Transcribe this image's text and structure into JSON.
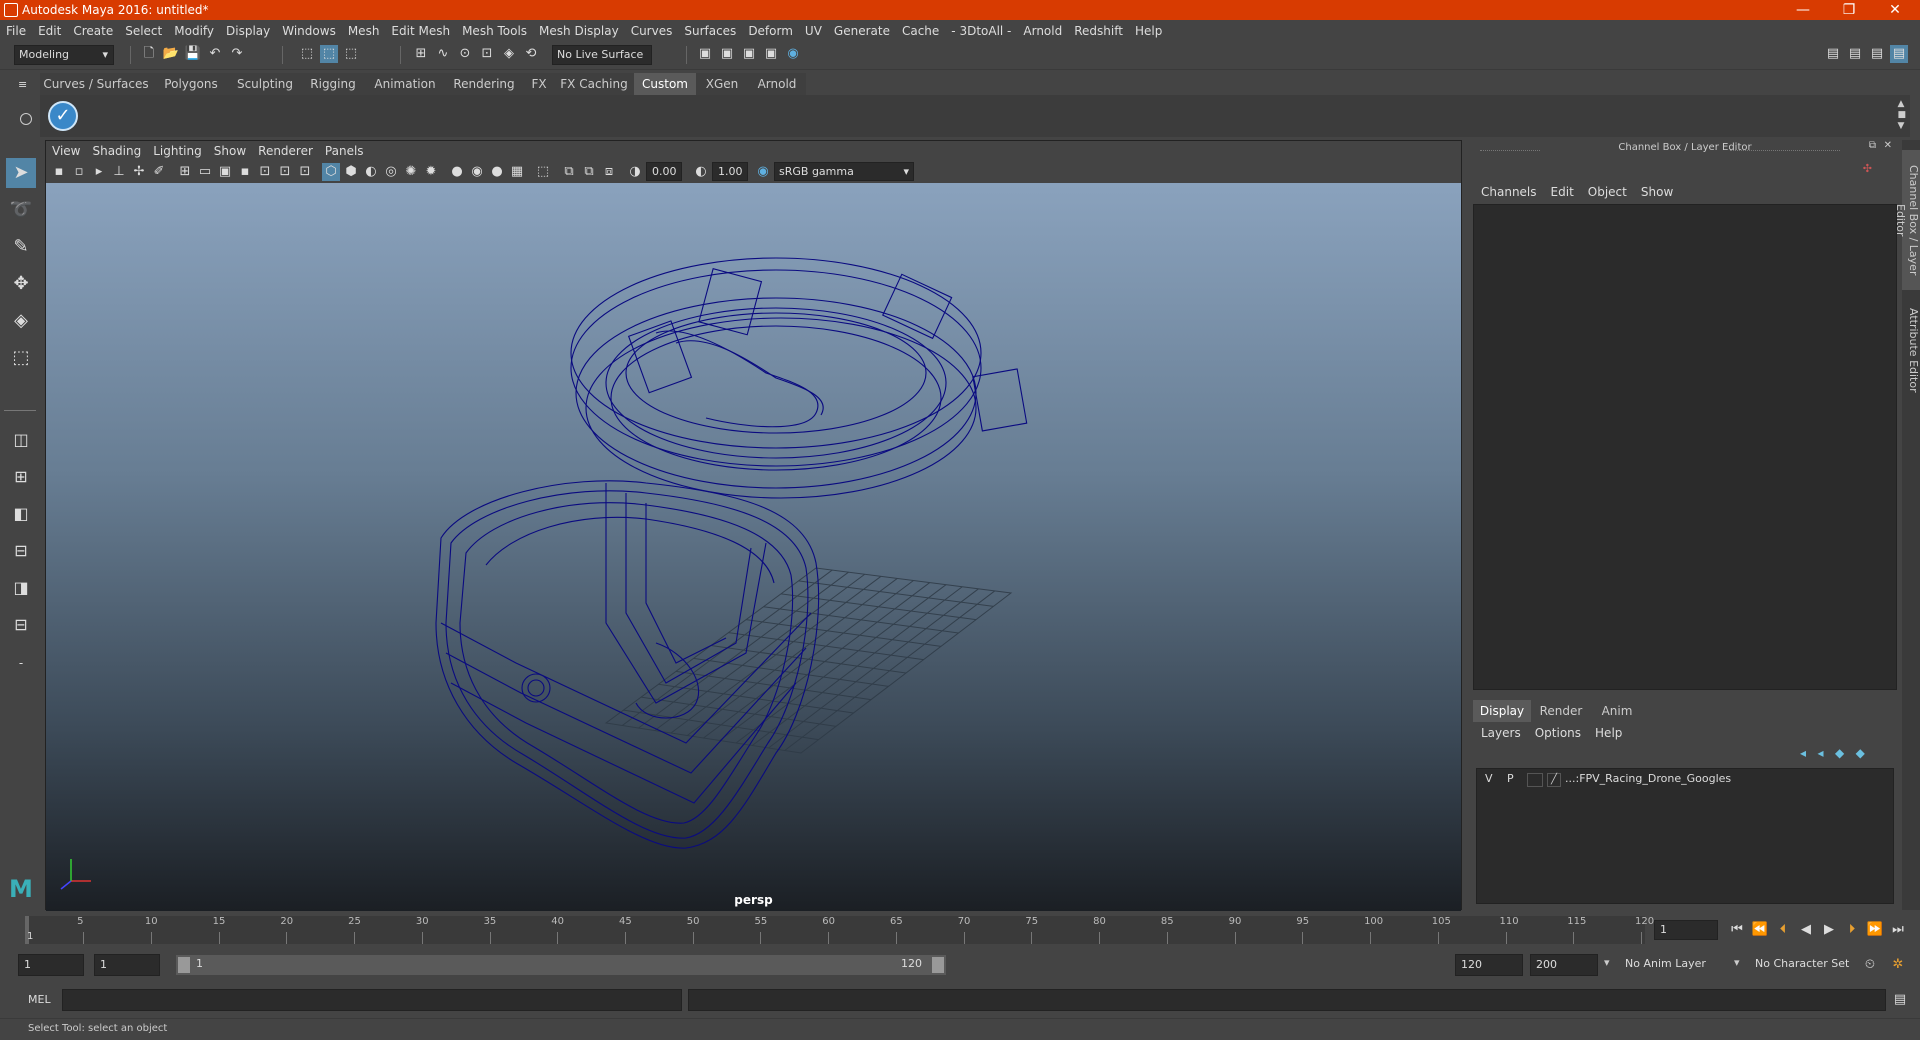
{
  "window": {
    "title": "Autodesk Maya 2016: untitled*",
    "minimize": "—",
    "maximize": "❐",
    "close": "✕"
  },
  "menubar": [
    "File",
    "Edit",
    "Create",
    "Select",
    "Modify",
    "Display",
    "Windows",
    "Mesh",
    "Edit Mesh",
    "Mesh Tools",
    "Mesh Display",
    "Curves",
    "Surfaces",
    "Deform",
    "UV",
    "Generate",
    "Cache",
    "- 3DtoAll -",
    "Arnold",
    "Redshift",
    "Help"
  ],
  "toolbar": {
    "mode": "Modeling",
    "live_surface": "No Live Surface"
  },
  "shelf": {
    "tabs": [
      "Curves / Surfaces",
      "Polygons",
      "Sculpting",
      "Rigging",
      "Animation",
      "Rendering",
      "FX",
      "FX Caching",
      "Custom",
      "XGen",
      "Arnold"
    ],
    "active_tab": "Custom"
  },
  "viewport": {
    "menu": [
      "View",
      "Shading",
      "Lighting",
      "Show",
      "Renderer",
      "Panels"
    ],
    "exposure": "0.00",
    "gamma": "1.00",
    "color_space": "sRGB gamma",
    "camera_label": "persp",
    "wire_color": "#0a0a80"
  },
  "channelbox": {
    "title": "Channel Box / Layer Editor",
    "menu": [
      "Channels",
      "Edit",
      "Object",
      "Show"
    ],
    "layer_tabs": [
      "Display",
      "Render",
      "Anim"
    ],
    "active_layer_tab": "Display",
    "layer_menu": [
      "Layers",
      "Options",
      "Help"
    ],
    "layer": {
      "visible": "V",
      "playback": "P",
      "name": "...:FPV_Racing_Drone_Googles"
    }
  },
  "side_tabs": [
    "Channel Box / Layer Editor",
    "Attribute Editor"
  ],
  "timeline": {
    "ticks": [
      "5",
      "10",
      "15",
      "20",
      "25",
      "30",
      "35",
      "40",
      "45",
      "50",
      "55",
      "60",
      "65",
      "70",
      "75",
      "80",
      "85",
      "90",
      "95",
      "100",
      "105",
      "110",
      "115",
      "120"
    ],
    "current_frame_marker": "1",
    "current_frame_field": "1"
  },
  "range": {
    "start": "1",
    "playback_start": "1",
    "slider_start": "1",
    "slider_end": "120",
    "playback_end": "120",
    "end": "200",
    "anim_layer": "No Anim Layer",
    "character_set": "No Character Set"
  },
  "cmdline": {
    "label": "MEL"
  },
  "helpline": {
    "text": "Select Tool: select an object"
  }
}
